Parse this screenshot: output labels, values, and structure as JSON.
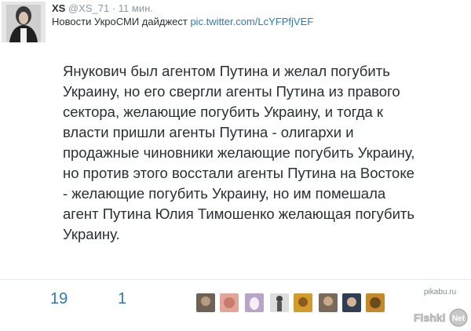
{
  "tweet": {
    "author_name": "XS",
    "author_handle": "@XS_71",
    "separator": "·",
    "time": "11 мин.",
    "headline_text": "Новости УкроСМИ дайджест",
    "headline_link": "pic.twitter.com/LcYFPfjVEF",
    "body": "Янукович был агентом Путина и желал погубить\nУкраину, но его свергли агенты Путина из правого\nсектора, желающие погубить Украину, и тогда к\nвласти пришли агенты Путина - олигархи и\nпродажные чиновники желающие погубить Украину,\nно против этого восстали агенты Путина на Востоке\n- желающие погубить Украину, но им помешала\nагент Путина Юлия Тимошенко желающая погубить\nУкраину.",
    "retweets": "19",
    "favorites": "1"
  },
  "watermarks": {
    "pikabu": "pikabu.ru",
    "fishki_text": "Fishki",
    "fishki_badge": "Net"
  },
  "colors": {
    "link": "#2b7bb9",
    "text": "#292f33",
    "muted": "#8899a6"
  }
}
